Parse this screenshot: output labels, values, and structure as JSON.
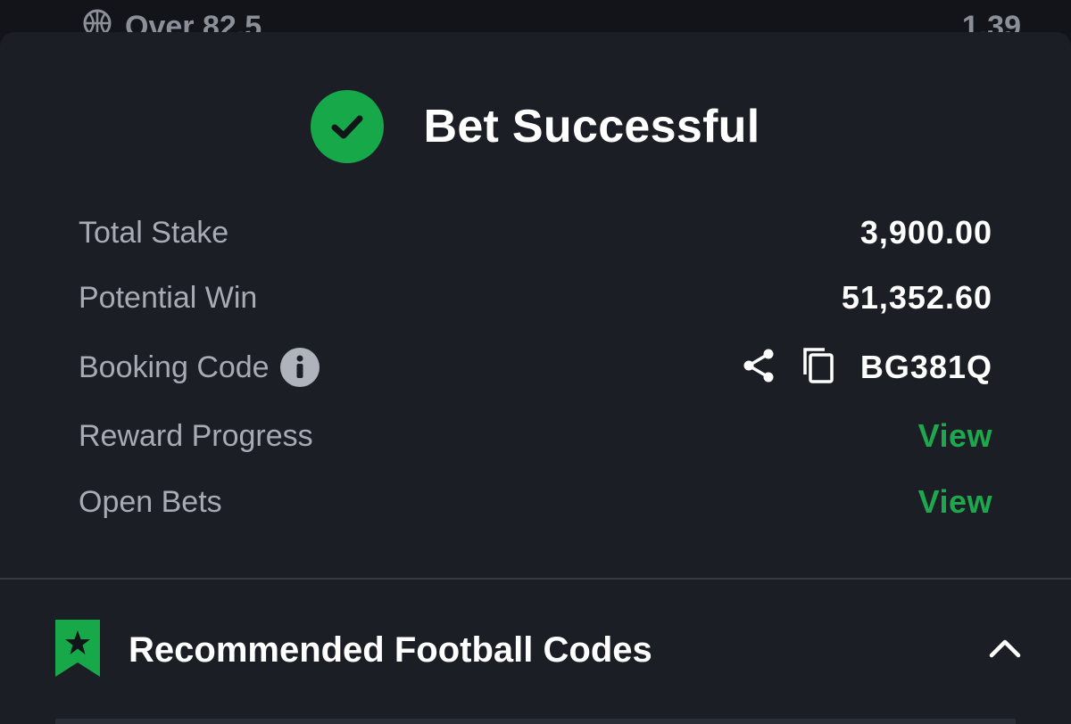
{
  "background_item": {
    "label": "Over 82.5",
    "odds": "1.39",
    "icon": "basketball-icon"
  },
  "header": {
    "title": "Bet Successful",
    "icon": "check-circle-icon",
    "icon_color": "#17a84a"
  },
  "summary": {
    "total_stake_label": "Total Stake",
    "total_stake_value": "3,900.00",
    "potential_win_label": "Potential Win",
    "potential_win_value": "51,352.60",
    "booking_code_label": "Booking Code",
    "booking_code_value": "BG381Q",
    "reward_progress_label": "Reward Progress",
    "reward_progress_link": "View",
    "open_bets_label": "Open Bets",
    "open_bets_link": "View"
  },
  "recommended": {
    "title": "Recommended Football Codes",
    "icon": "bookmark-star-icon",
    "toggle_icon": "chevron-up-icon"
  },
  "colors": {
    "accent_green": "#1ea84d",
    "background": "#1b1e25",
    "label_gray": "#a6abb4"
  }
}
